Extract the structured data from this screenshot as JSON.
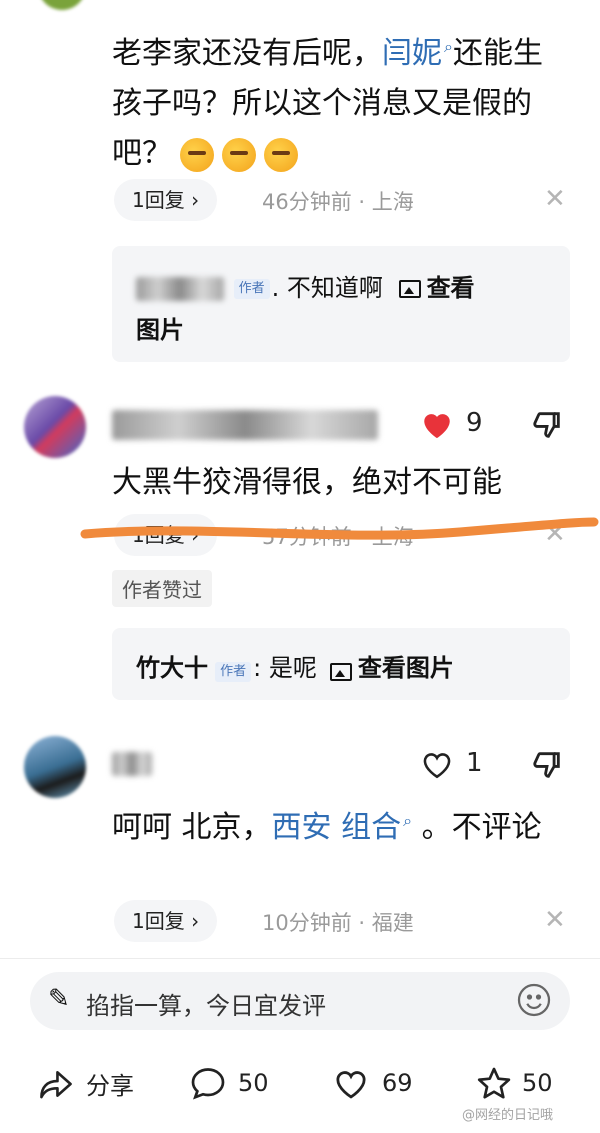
{
  "comment1": {
    "text_before": "老李家还没有后呢，",
    "mention": "闫妮",
    "text_after": "还能生孩子吗？所以这个消息又是假的吧？",
    "reply_button": "1回复 ›",
    "meta": "46分钟前 · 上海",
    "reply": {
      "badge": "作者",
      "text": ". 不知道啊",
      "link": "查看",
      "link2": "图片"
    }
  },
  "comment2": {
    "like_count": "9",
    "text": "大黑牛狡滑得很，绝对不可能",
    "reply_button": "1回复 ›",
    "meta": "57分钟前 · 上海",
    "tag": "作者赞过",
    "reply": {
      "name": "竹大十",
      "badge": "作者",
      "text": ": 是呢",
      "link": "查看图片"
    }
  },
  "comment3": {
    "like_count": "1",
    "text_before": "呵呵 北京，",
    "mention": "西安 组合",
    "text_after": " 。不评论",
    "reply_button": "1回复 ›",
    "meta": "10分钟前 · 福建"
  },
  "input": {
    "placeholder": "掐指一算，今日宜发评"
  },
  "bottom_bar": {
    "share": "分享",
    "comments": "50",
    "likes": "69",
    "favorites": "50"
  },
  "watermark": "@网经的日记哦",
  "colors": {
    "mention": "#2f6db4",
    "heart": "#e8333a",
    "underline": "#f08a3c"
  }
}
